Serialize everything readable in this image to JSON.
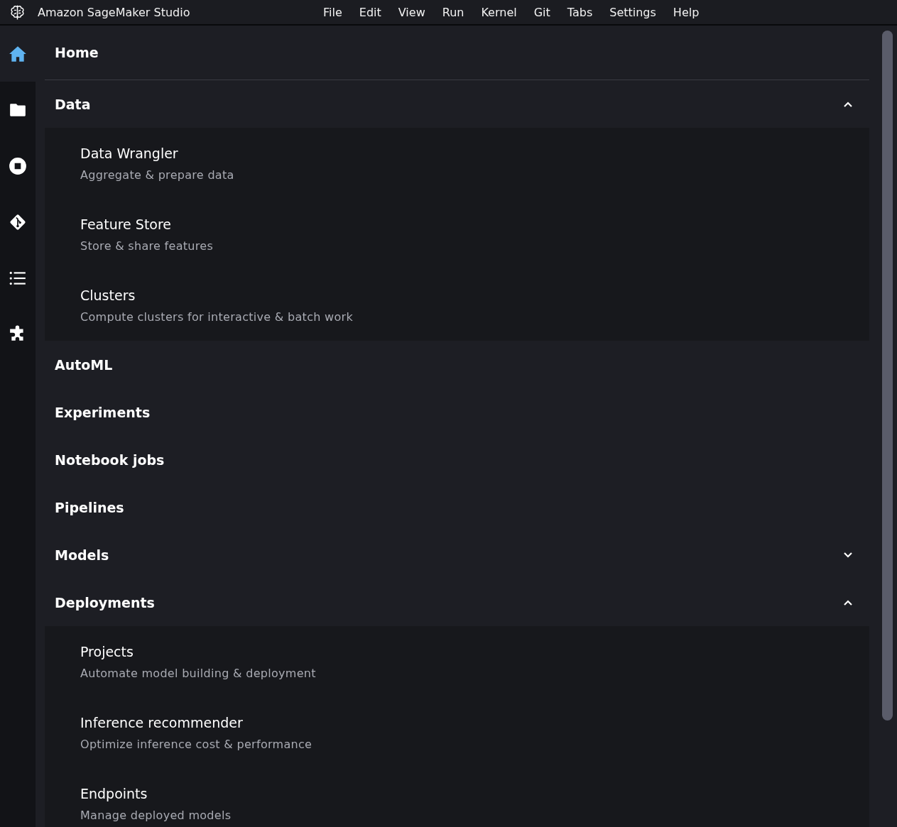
{
  "app": {
    "title": "Amazon SageMaker Studio"
  },
  "menu": [
    "File",
    "Edit",
    "View",
    "Run",
    "Kernel",
    "Git",
    "Tabs",
    "Settings",
    "Help"
  ],
  "sidebar": [
    {
      "kind": "home",
      "selected": true
    },
    {
      "kind": "folder",
      "selected": false
    },
    {
      "kind": "stop",
      "selected": false
    },
    {
      "kind": "git",
      "selected": false
    },
    {
      "kind": "list",
      "selected": false
    },
    {
      "kind": "puzzle",
      "selected": false
    }
  ],
  "sections": [
    {
      "kind": "link",
      "title": "Home"
    },
    {
      "kind": "group",
      "title": "Data",
      "expanded": true,
      "children": [
        {
          "title": "Data Wrangler",
          "description": "Aggregate & prepare data"
        },
        {
          "title": "Feature Store",
          "description": "Store & share features"
        },
        {
          "title": "Clusters",
          "description": "Compute clusters for interactive & batch work"
        }
      ]
    },
    {
      "kind": "link",
      "title": "AutoML"
    },
    {
      "kind": "link",
      "title": "Experiments"
    },
    {
      "kind": "link",
      "title": "Notebook jobs"
    },
    {
      "kind": "link",
      "title": "Pipelines"
    },
    {
      "kind": "group",
      "title": "Models",
      "expanded": false
    },
    {
      "kind": "group",
      "title": "Deployments",
      "expanded": true,
      "children": [
        {
          "title": "Projects",
          "description": "Automate model building & deployment"
        },
        {
          "title": "Inference recommender",
          "description": "Optimize inference cost & performance"
        },
        {
          "title": "Endpoints",
          "description": "Manage deployed models"
        }
      ]
    }
  ]
}
